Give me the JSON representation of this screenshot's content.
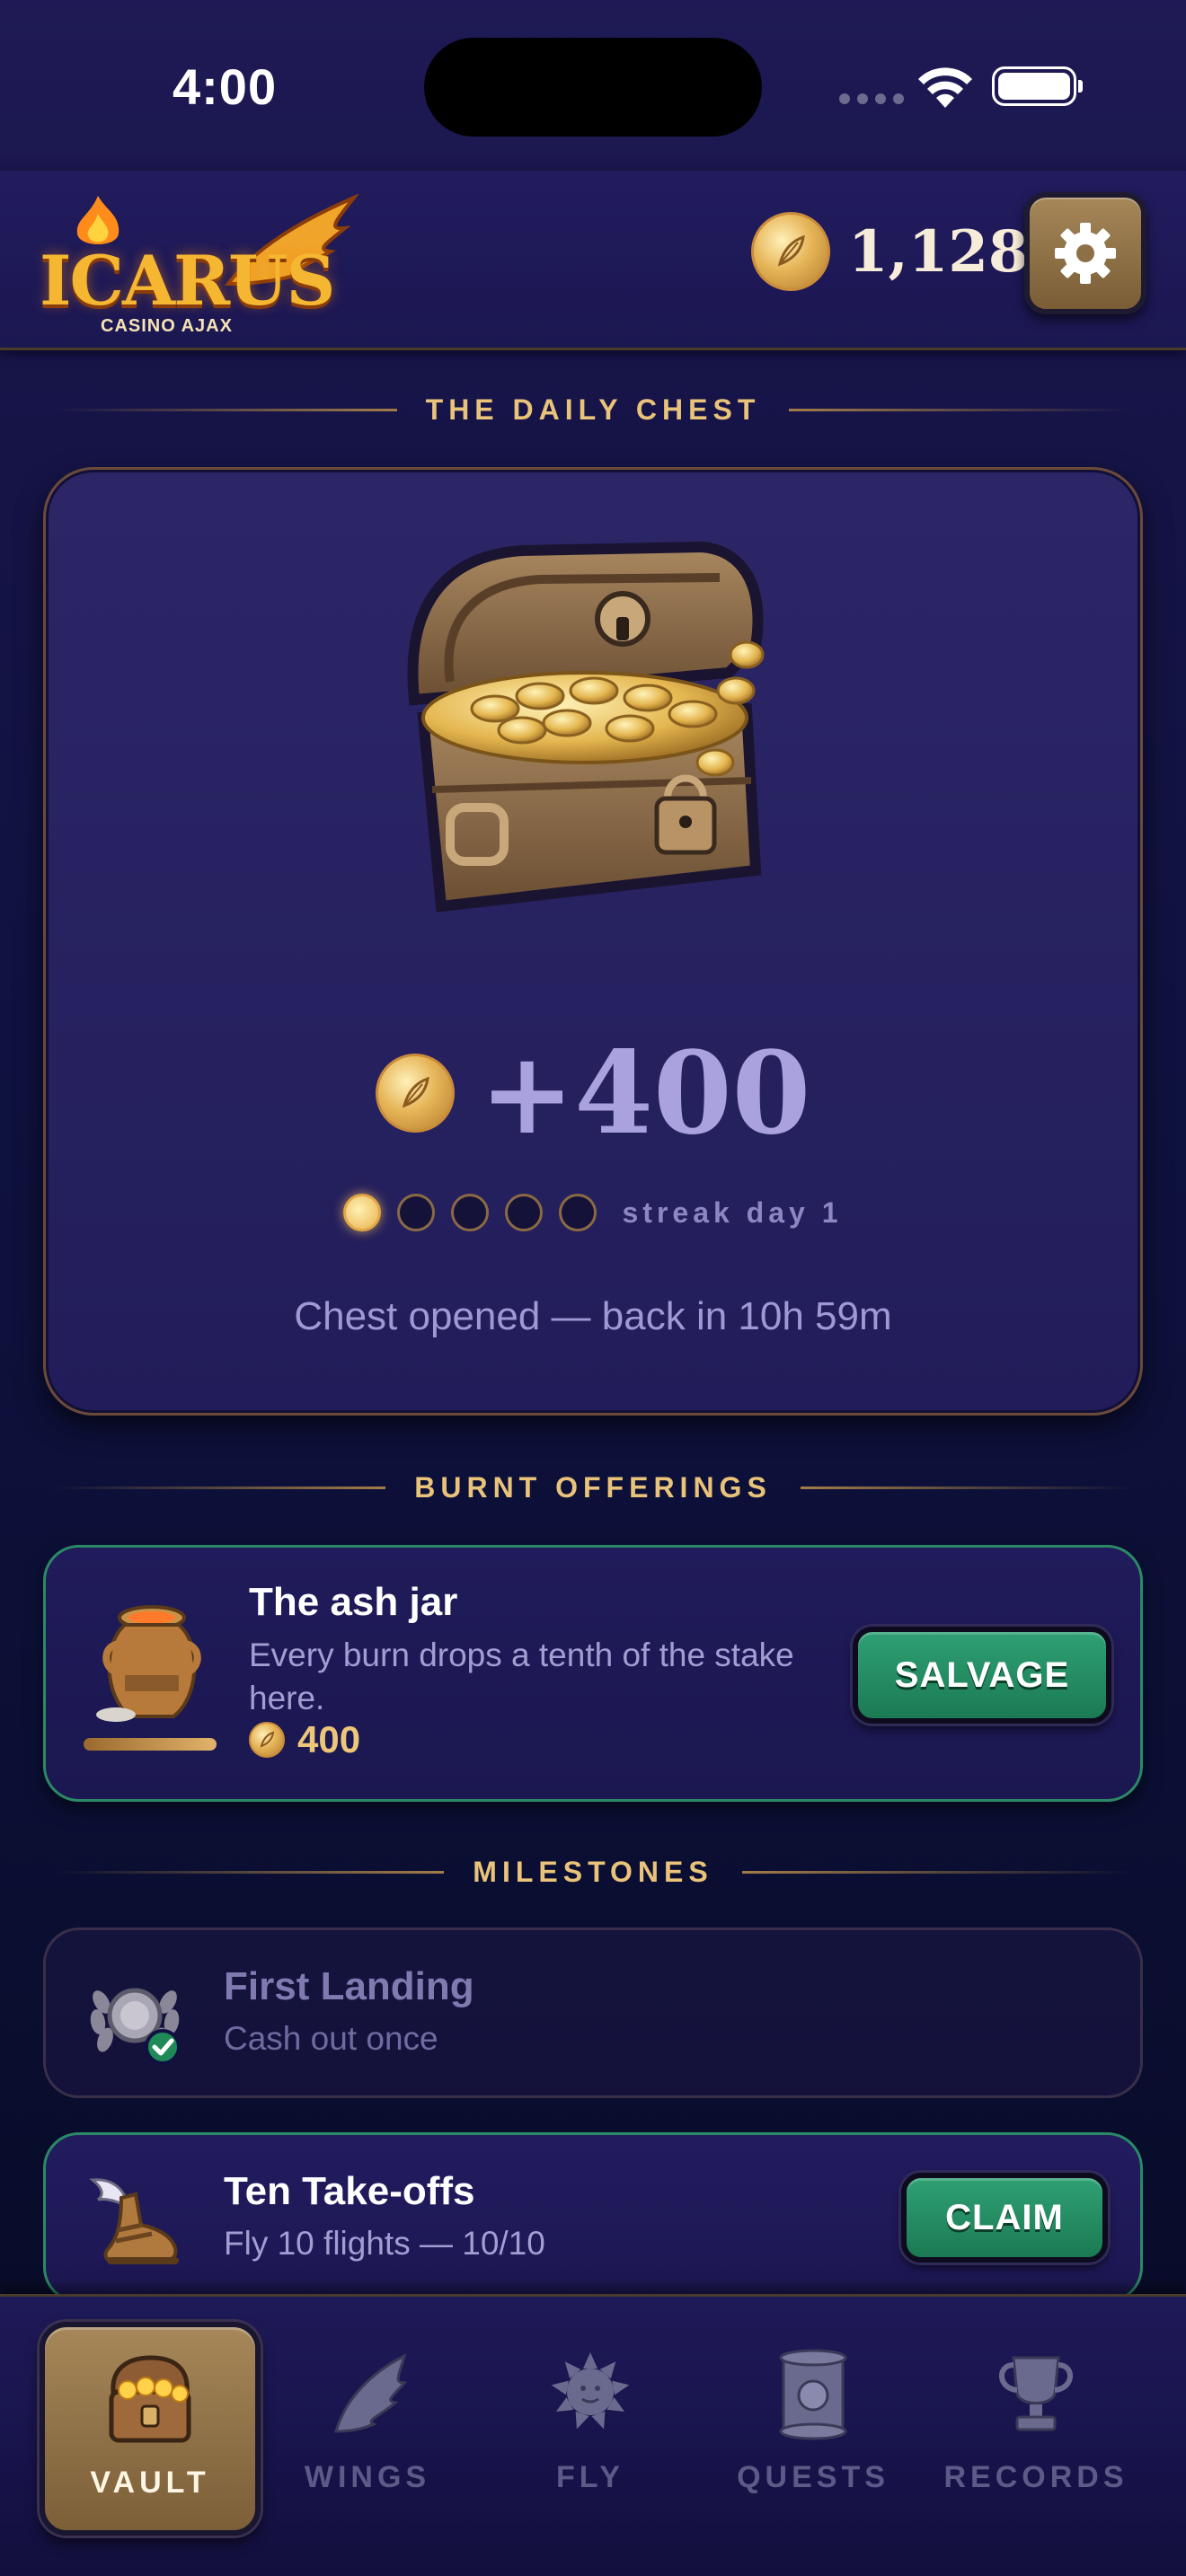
{
  "status_bar": {
    "time": "4:00"
  },
  "header": {
    "logo_title": "ICARUS",
    "logo_subtitle": "CASINO AJAX",
    "balance": "1,128",
    "icons": {
      "coin": "feather-coin-icon",
      "settings": "gear-icon"
    }
  },
  "daily_chest": {
    "section_title": "THE DAILY CHEST",
    "reward": "+400",
    "streak_total": 5,
    "streak_filled": 1,
    "streak_label": "streak day 1",
    "status": "Chest opened — back in 10h 59m"
  },
  "offerings": {
    "section_title": "BURNT OFFERINGS",
    "ash_jar": {
      "title": "The ash jar",
      "description": "Every burn drops a tenth of the stake here.",
      "amount": "400",
      "button": "SALVAGE"
    }
  },
  "milestones": {
    "section_title": "MILESTONES",
    "items": [
      {
        "title": "First Landing",
        "subtitle": "Cash out once",
        "icon": "laurel-medal-icon",
        "state": "completed"
      },
      {
        "title": "Ten Take-offs",
        "subtitle": "Fly 10 flights — 10/10",
        "icon": "winged-sandal-icon",
        "button": "CLAIM"
      }
    ]
  },
  "tabbar": {
    "tabs": [
      {
        "label": "VAULT",
        "icon": "treasure-chest-icon",
        "active": true
      },
      {
        "label": "WINGS",
        "icon": "wing-icon",
        "active": false
      },
      {
        "label": "FLY",
        "icon": "sun-icon",
        "active": false
      },
      {
        "label": "QUESTS",
        "icon": "scroll-icon",
        "active": false
      },
      {
        "label": "RECORDS",
        "icon": "trophy-icon",
        "active": false
      }
    ]
  },
  "colors": {
    "accent_gold": "#e9c37a",
    "claim_green": "#2fa074",
    "background": "#171448"
  }
}
